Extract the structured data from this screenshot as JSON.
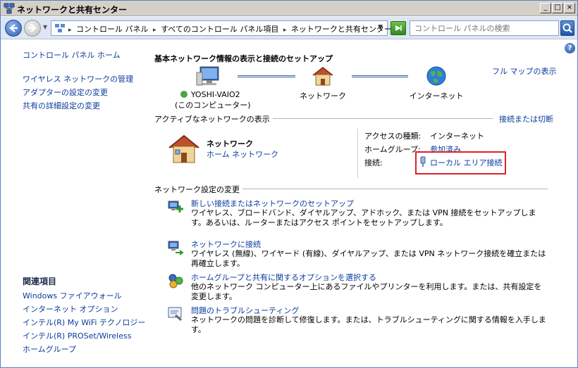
{
  "window": {
    "title": "ネットワークと共有センター",
    "min_glyph": "_",
    "max_glyph": "□",
    "close_glyph": "×"
  },
  "address": {
    "crumbs": [
      "コントロール パネル",
      "すべてのコントロール パネル項目",
      "ネットワークと共有センター"
    ],
    "search_placeholder": "コントロール パネルの検索"
  },
  "sidebar": {
    "home": "コントロール パネル ホーム",
    "links": [
      "ワイヤレス ネットワークの管理",
      "アダプターの設定の変更",
      "共有の詳細設定の変更"
    ],
    "related_heading": "関連項目",
    "related": [
      "Windows ファイアウォール",
      "インターネット オプション",
      "インテル(R) My WiFi テクノロジー",
      "インテル(R) PROSet/Wireless",
      "ホームグループ"
    ]
  },
  "main": {
    "title": "基本ネットワーク情報の表示と接続のセットアップ",
    "full_map": "フル マップの表示",
    "map": {
      "computer_name": "YOSHI-VAIO2",
      "computer_sub": "(このコンピューター)",
      "network": "ネットワーク",
      "internet": "インターネット"
    },
    "active_heading": "アクティブなネットワークの表示",
    "connect_or_disconnect": "接続または切断",
    "active_network": {
      "name": "ネットワーク",
      "type": "ホーム ネットワーク",
      "access_label": "アクセスの種類:",
      "access_value": "インターネット",
      "homegroup_label": "ホームグループ:",
      "homegroup_value": "参加済み",
      "connection_label": "接続:",
      "connection_value": "ローカル エリア接続"
    },
    "settings_heading": "ネットワーク設定の変更",
    "tasks": [
      {
        "link": "新しい接続またはネットワークのセットアップ",
        "desc": "ワイヤレス、ブロードバンド、ダイヤルアップ、アドホック、または VPN 接続をセットアップします。あるいは、ルーターまたはアクセス ポイントをセットアップします。"
      },
      {
        "link": "ネットワークに接続",
        "desc": "ワイヤレス (無線)、ワイヤード (有線)、ダイヤルアップ、または VPN ネットワーク接続を確立または再確立します。"
      },
      {
        "link": "ホームグループと共有に関するオプションを選択する",
        "desc": "他のネットワーク コンピューター上にあるファイルやプリンターを利用します。または、共有設定を変更します。"
      },
      {
        "link": "問題のトラブルシューティング",
        "desc": "ネットワークの問題を診断して修復します。または、トラブルシューティングに関する情報を入手します。"
      }
    ]
  },
  "colors": {
    "link": "#0a3c9c",
    "highlight": "#e0202a"
  }
}
